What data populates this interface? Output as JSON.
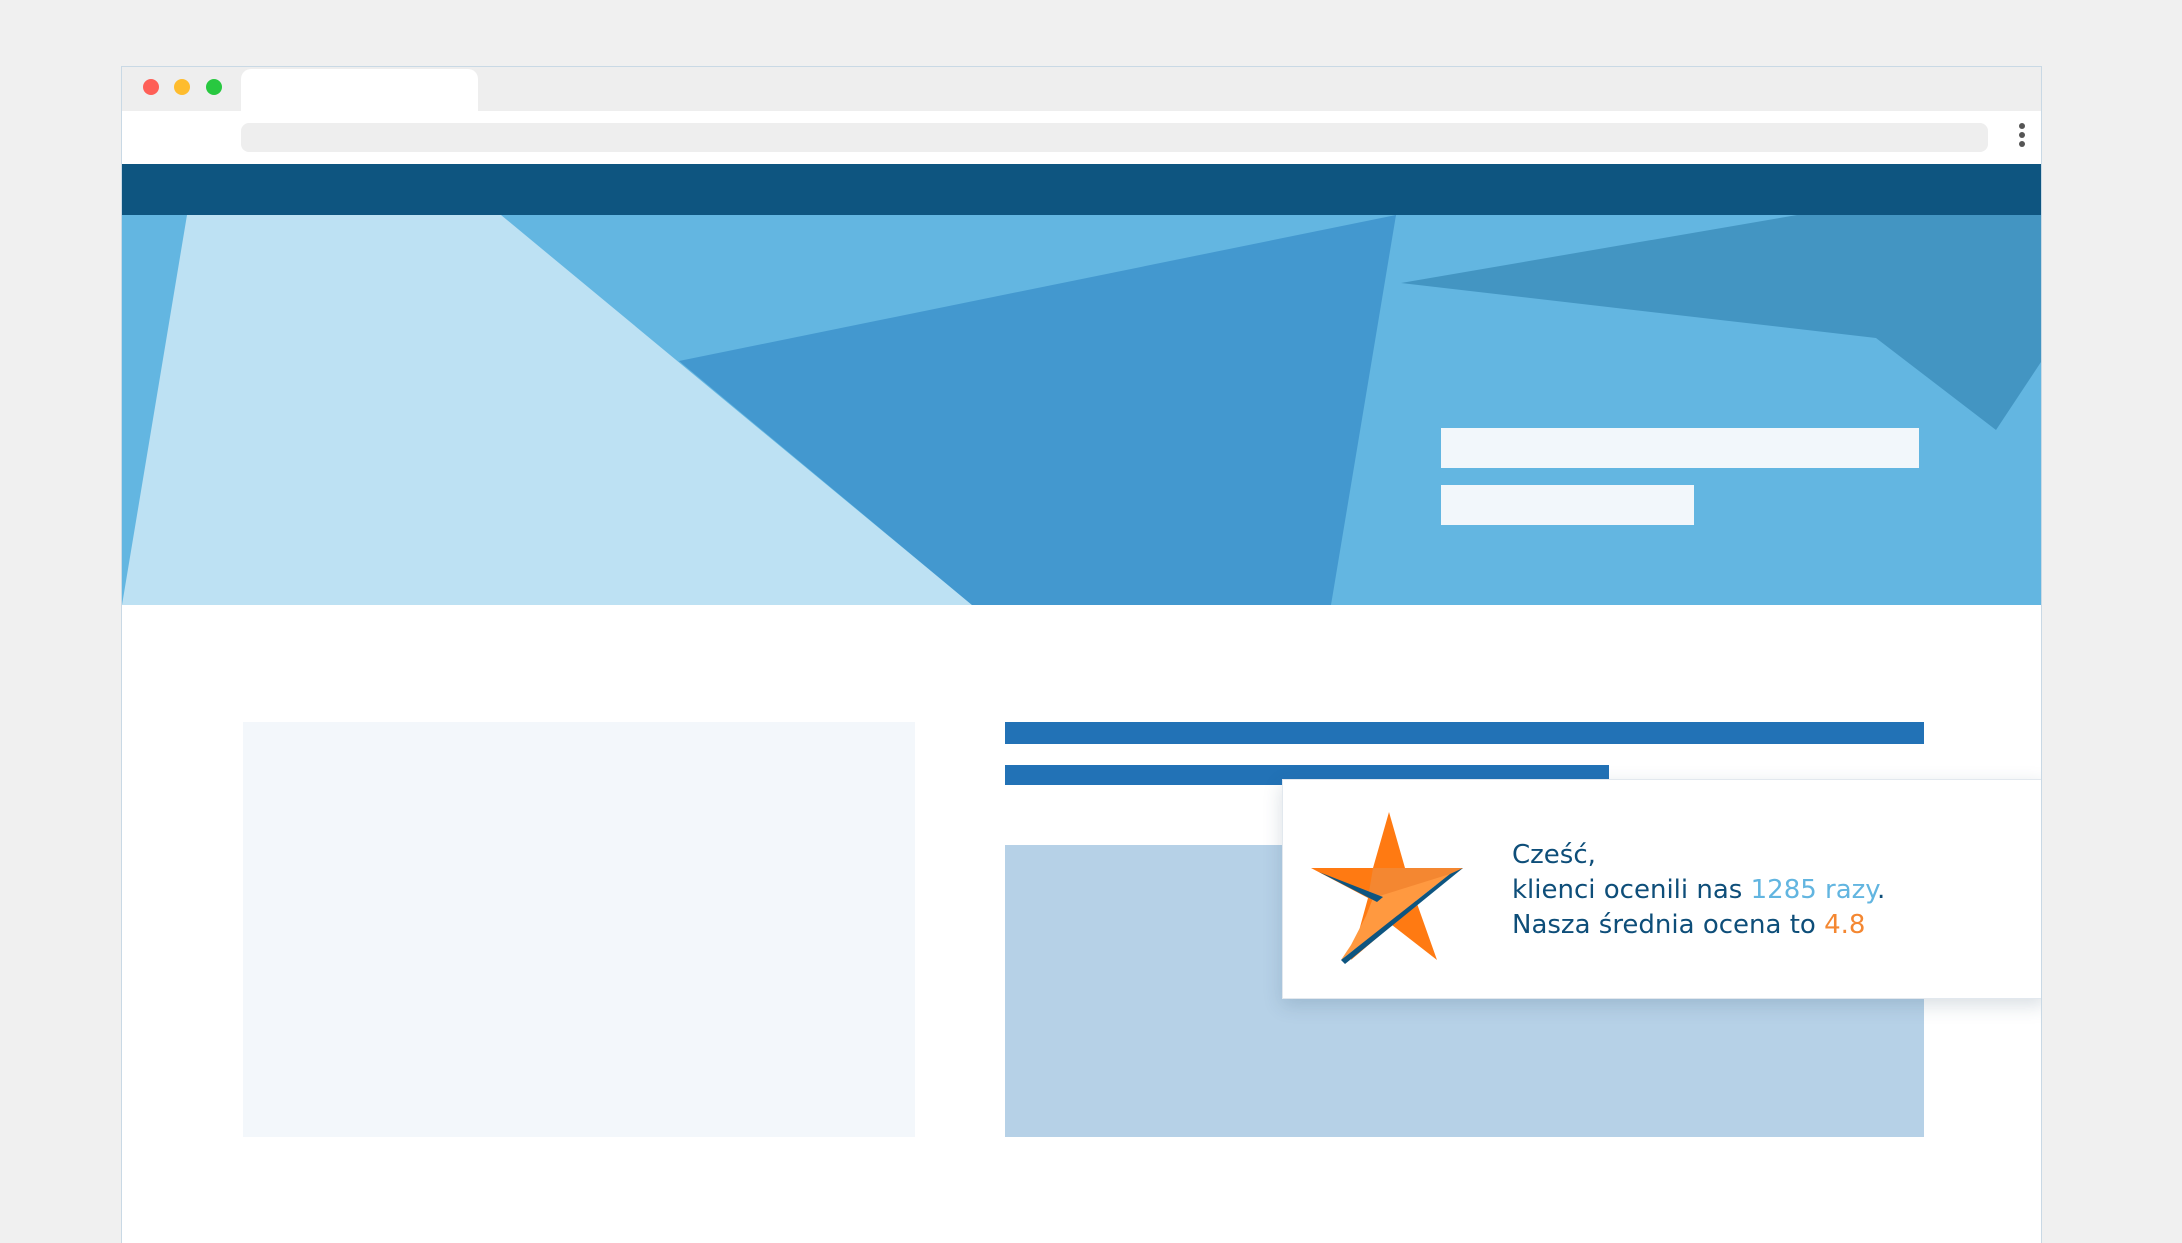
{
  "widget": {
    "greeting": "Cześć,",
    "line2_prefix": "klienci ocenili nas ",
    "rating_count": "1285 razy",
    "line2_suffix": ".",
    "line3_prefix": "Nasza średnia ocena to ",
    "average_rating": "4.8",
    "icon": "star-logo-icon"
  },
  "colors": {
    "navbar": "#0e5580",
    "hero_light": "#bde1f3",
    "hero_mid": "#63b6e1",
    "hero_dark": "#4398cf",
    "accent_blue": "#2272b6",
    "accent_orange": "#f48731",
    "text": "#0e4e79"
  }
}
